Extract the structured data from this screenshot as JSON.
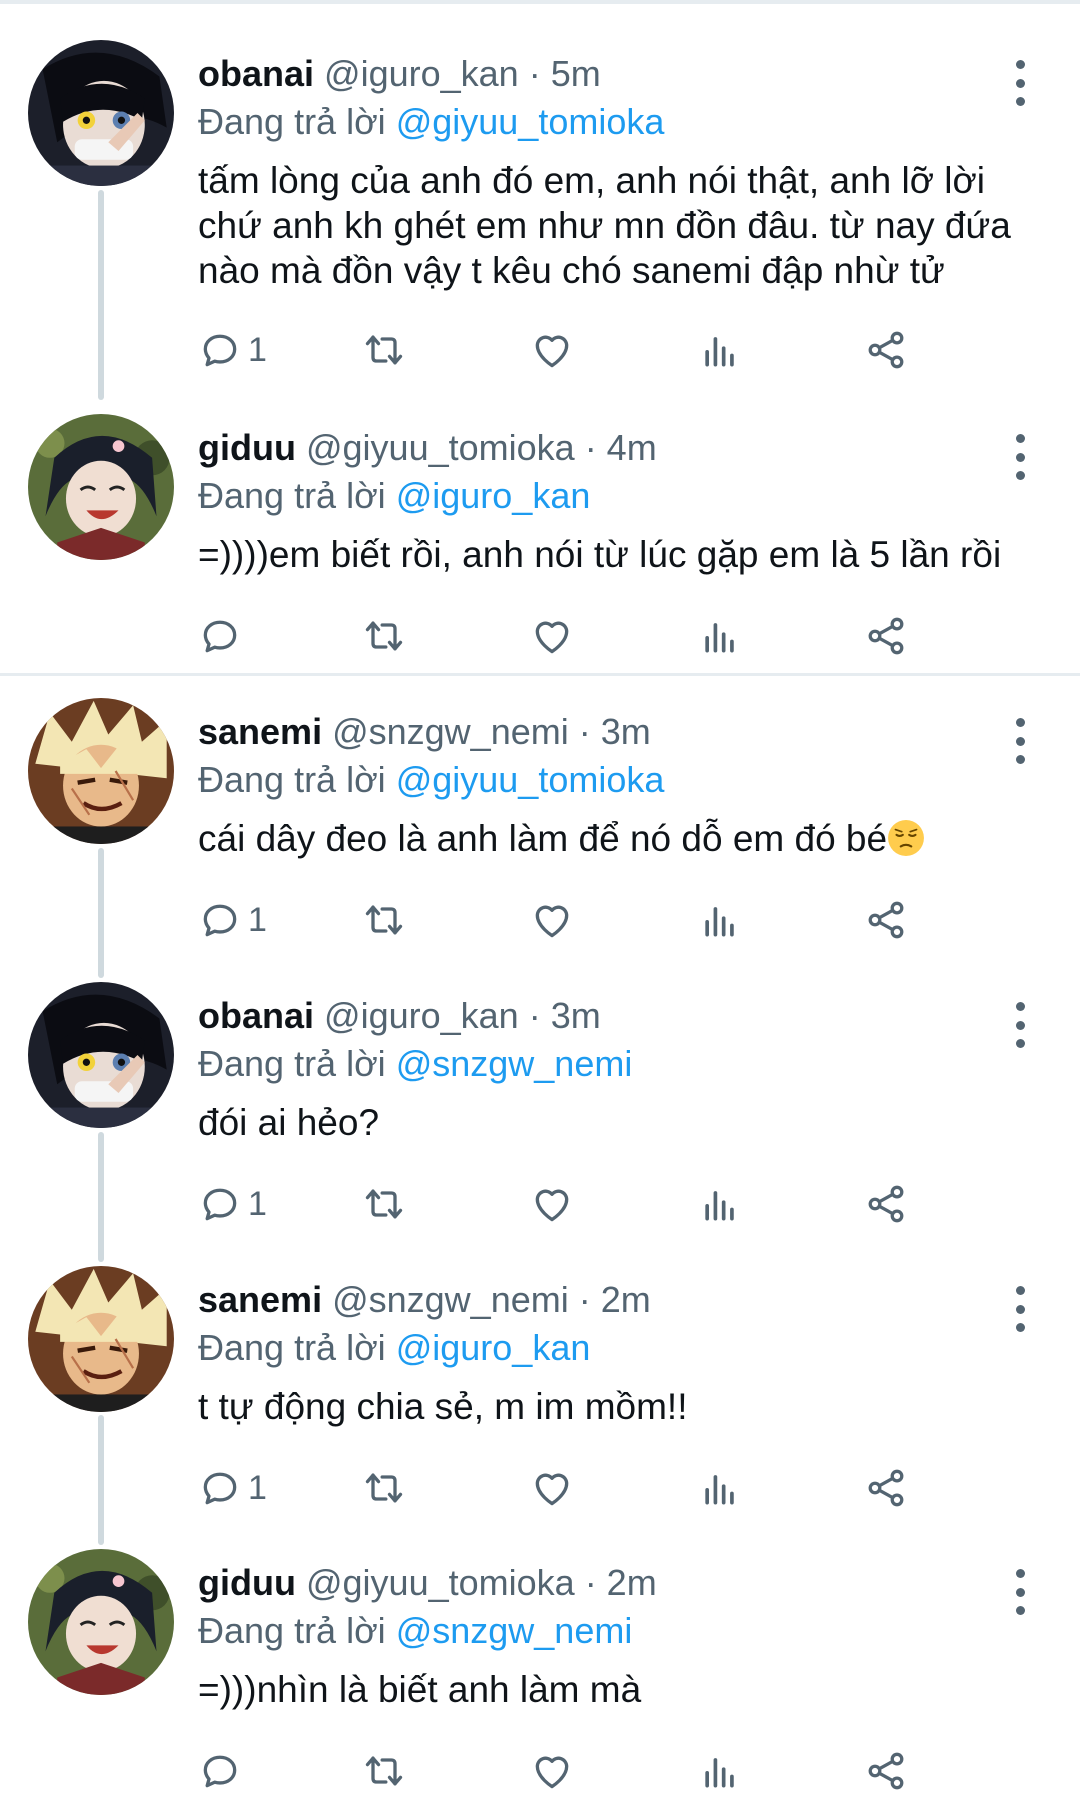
{
  "colors": {
    "link": "#1d9bf0",
    "muted": "#536471",
    "text": "#0f1419",
    "thread_line": "#cfd9de"
  },
  "tweets": [
    {
      "name": "obanai",
      "handle": "@iguro_kan",
      "time": "· 5m",
      "replying_label": "Đang trả lời",
      "replying_to": "@giyuu_tomioka",
      "text": "tấm lòng của anh đó em, anh nói thật, anh lỡ lời chứ anh kh ghét em như mn đồn đâu. từ nay đứa nào mà đồn vậy t kêu chó sanemi đập nhừ tử",
      "reply_count": "1",
      "avatar": "obanai-avatar"
    },
    {
      "name": "giduu",
      "handle": "@giyuu_tomioka",
      "time": "· 4m",
      "replying_label": "Đang trả lời",
      "replying_to": "@iguro_kan",
      "text": "=))))em biết rồi, anh nói từ lúc gặp em là 5 lần rồi",
      "reply_count": "",
      "avatar": "giduu-avatar"
    },
    {
      "name": "sanemi",
      "handle": "@snzgw_nemi",
      "time": "· 3m",
      "replying_label": "Đang trả lời",
      "replying_to": "@giyuu_tomioka",
      "text": "cái dây đeo là anh làm để nó dỗ em đó bé",
      "emoji": "pensive-face-emoji",
      "reply_count": "1",
      "avatar": "sanemi-avatar"
    },
    {
      "name": "obanai",
      "handle": "@iguro_kan",
      "time": "· 3m",
      "replying_label": "Đang trả lời",
      "replying_to": "@snzgw_nemi",
      "text": "đói ai hẻo?",
      "reply_count": "1",
      "avatar": "obanai-avatar"
    },
    {
      "name": "sanemi",
      "handle": "@snzgw_nemi",
      "time": "· 2m",
      "replying_label": "Đang trả lời",
      "replying_to": "@iguro_kan",
      "text": "t tự động chia sẻ, m im mồm!!",
      "reply_count": "1",
      "avatar": "sanemi-avatar"
    },
    {
      "name": "giduu",
      "handle": "@giyuu_tomioka",
      "time": "· 2m",
      "replying_label": "Đang trả lời",
      "replying_to": "@snzgw_nemi",
      "text": "=)))nhìn là biết anh làm mà",
      "reply_count": "",
      "avatar": "giduu-avatar"
    }
  ],
  "icons": {
    "reply": "reply-icon",
    "retweet": "retweet-icon",
    "like": "heart-icon",
    "views": "views-icon",
    "share": "share-icon",
    "more": "more-options-icon"
  }
}
